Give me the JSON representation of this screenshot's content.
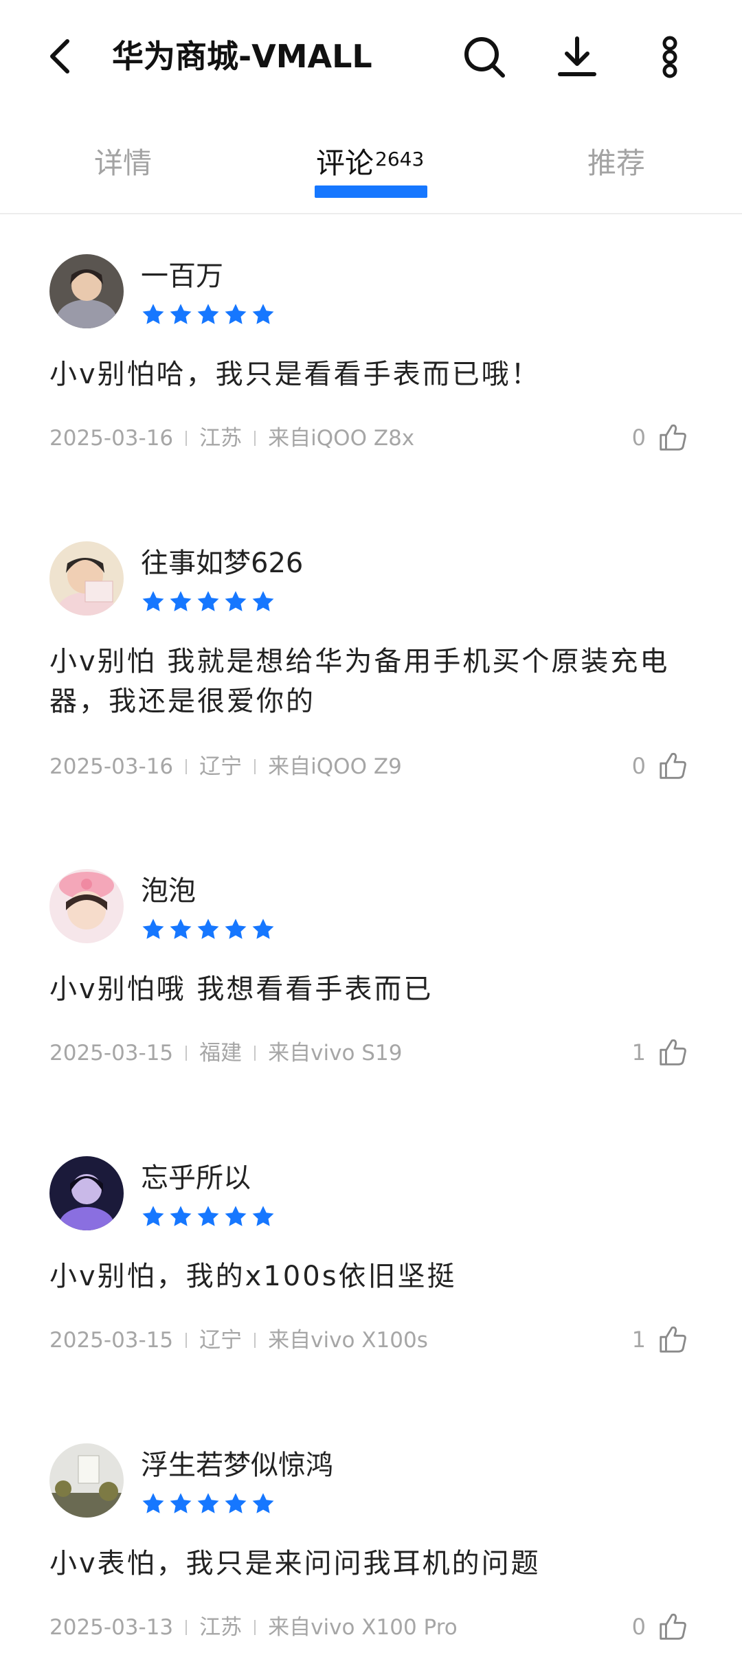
{
  "header": {
    "title": "华为商城-VMALL",
    "icons": [
      "back-arrow-icon",
      "search-icon",
      "download-icon",
      "more-vertical-icon"
    ]
  },
  "tabs": [
    {
      "label": "详情",
      "active": false
    },
    {
      "label": "评论",
      "count": "2643",
      "active": true
    },
    {
      "label": "推荐",
      "active": false
    }
  ],
  "colors": {
    "accent": "#1677ff",
    "muted": "#a6a6a6",
    "text": "#222222"
  },
  "reviews": [
    {
      "username": "一百万",
      "rating": 5,
      "content": "小v别怕哈，我只是看看手表而已哦！",
      "date": "2025-03-16",
      "region": "江苏",
      "device": "来自iQOO Z8x",
      "likes": "0"
    },
    {
      "username": "往事如梦626",
      "rating": 5,
      "content": "小v别怕 我就是想给华为备用手机买个原装充电器，我还是很爱你的",
      "date": "2025-03-16",
      "region": "辽宁",
      "device": "来自iQOO Z9",
      "likes": "0"
    },
    {
      "username": "泡泡",
      "rating": 5,
      "content": "小v别怕哦 我想看看手表而已",
      "date": "2025-03-15",
      "region": "福建",
      "device": "来自vivo S19",
      "likes": "1"
    },
    {
      "username": "忘乎所以",
      "rating": 5,
      "content": "小v别怕，我的x100s依旧坚挺",
      "date": "2025-03-15",
      "region": "辽宁",
      "device": "来自vivo X100s",
      "likes": "1"
    },
    {
      "username": "浮生若梦似惊鸿",
      "rating": 5,
      "content": "小v表怕，我只是来问问我耳机的问题",
      "date": "2025-03-13",
      "region": "江苏",
      "device": "来自vivo X100 Pro",
      "likes": "0"
    }
  ]
}
